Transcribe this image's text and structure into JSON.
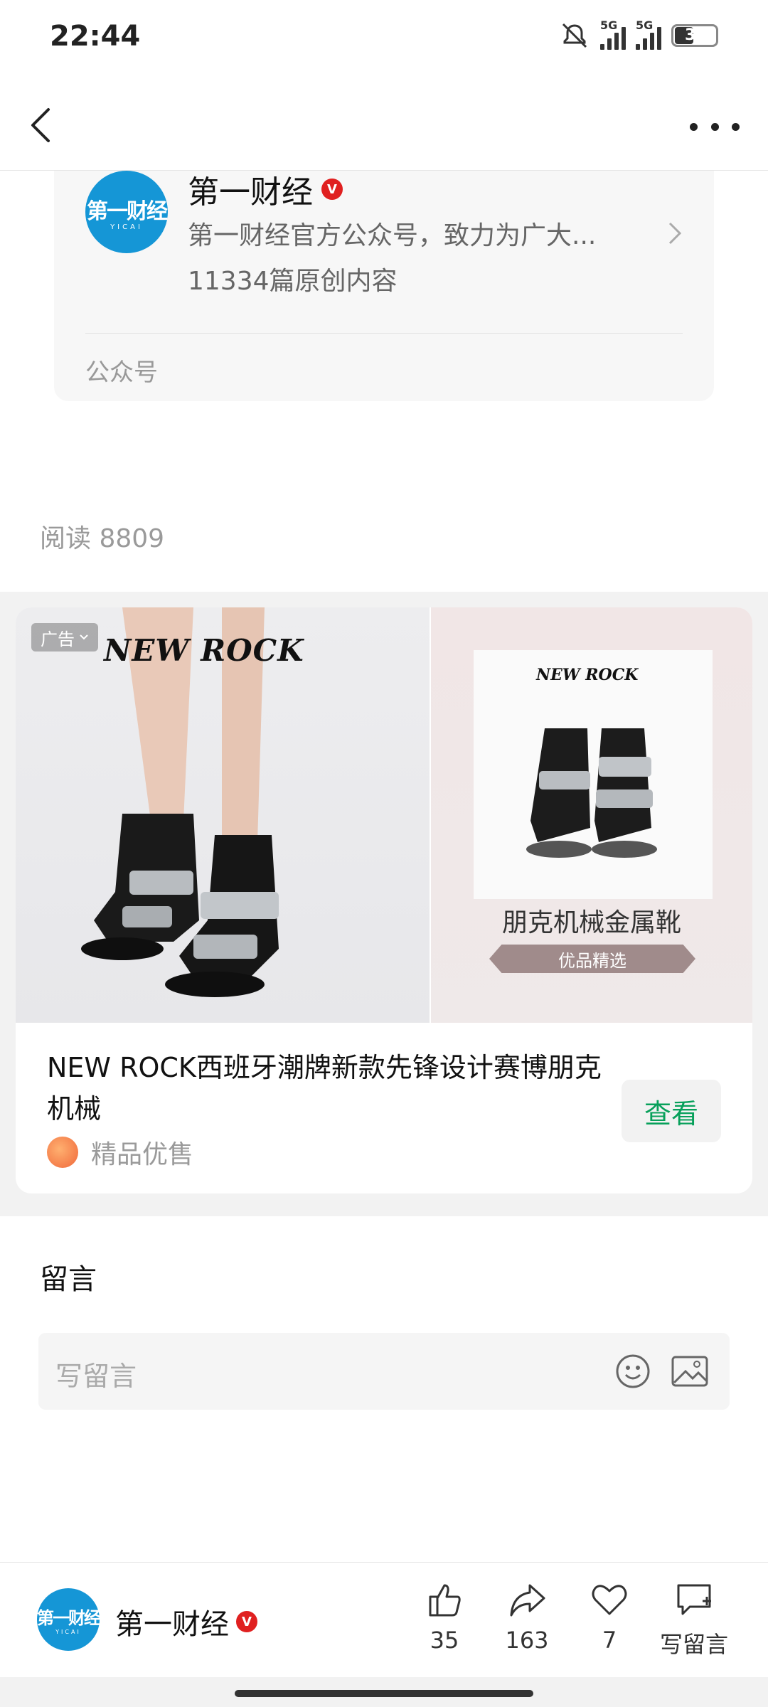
{
  "status_bar": {
    "time": "22:44",
    "network_1": "5G",
    "network_2": "5G",
    "battery": "31"
  },
  "account": {
    "logo_text": "第一财经",
    "logo_sub": "YICAI",
    "name": "第一财经",
    "verified_badge": "V",
    "description": "第一财经官方公众号，致力为广大...",
    "article_count": "11334篇原创内容",
    "type": "公众号"
  },
  "article": {
    "read_count": "阅读 8809"
  },
  "ad": {
    "tag": "广告",
    "brand": "NEW ROCK",
    "product_title": "朋克机械金属靴",
    "ribbon": "优品精选",
    "title": "NEW ROCK西班牙潮牌新款先锋设计赛博朋克机械",
    "source": "精品优售",
    "cta": "查看",
    "cta_color": "#07a05a"
  },
  "comments": {
    "title": "留言",
    "input_placeholder": "写留言"
  },
  "bottom_bar": {
    "name": "第一财经",
    "verified_badge": "V",
    "like_count": "35",
    "share_count": "163",
    "favorite_count": "7",
    "comment_label": "写留言"
  },
  "colors": {
    "logo_blue": "#1596d6",
    "verified_red": "#e02020"
  },
  "icons": [
    "back-icon",
    "more-icon",
    "chevron-right-icon",
    "emoji-icon",
    "image-icon",
    "thumbs-up-icon",
    "share-icon",
    "heart-icon",
    "comment-icon"
  ]
}
